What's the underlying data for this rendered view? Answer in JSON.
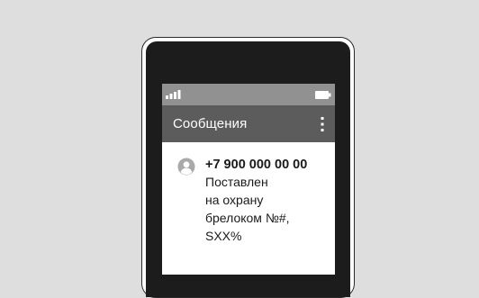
{
  "status_bar": {
    "signal_icon": "signal-bars-icon",
    "battery_icon": "battery-icon"
  },
  "app_bar": {
    "title": "Сообщения",
    "menu_icon": "more-vert-icon"
  },
  "message": {
    "avatar_icon": "user-avatar-icon",
    "sender": "+7 900 000 00 00",
    "lines": [
      "Поставлен",
      "на охрану",
      "брелоком №#,",
      "SXX%"
    ]
  },
  "colors": {
    "background": "#dedede",
    "phone_frame": "#1c1c1c",
    "status_bar": "#919191",
    "app_bar": "#5c5c5c",
    "text": "#1a1a1a",
    "avatar": "#a9a9a9"
  }
}
